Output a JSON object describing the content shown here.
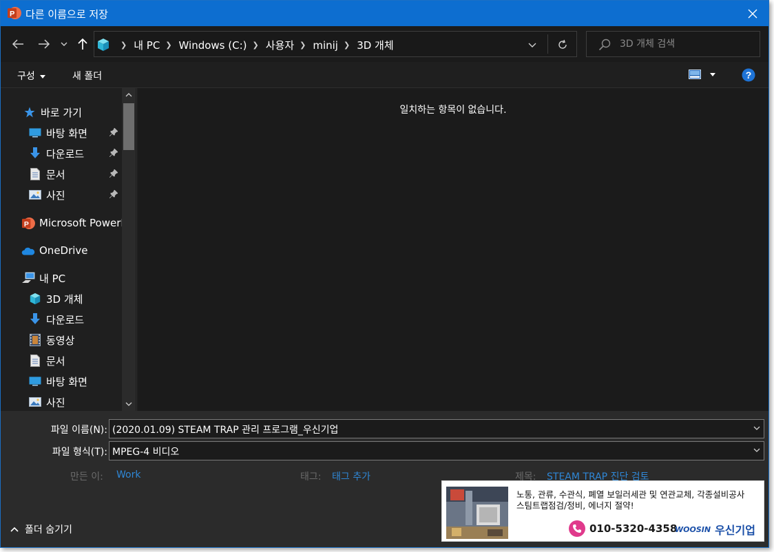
{
  "window": {
    "title": "다른 이름으로 저장",
    "app_icon": "powerpoint-icon",
    "accent_color": "#0d6ed0"
  },
  "navigation": {
    "breadcrumbs": [
      "내 PC",
      "Windows (C:)",
      "사용자",
      "minij",
      "3D 개체"
    ],
    "search_placeholder": "3D 개체 검색"
  },
  "toolbar": {
    "organize_label": "구성",
    "new_folder_label": "새 폴더"
  },
  "sidebar": {
    "items": [
      {
        "label": "바로 가기",
        "icon": "star-icon"
      },
      {
        "label": "바탕 화면",
        "icon": "desktop-icon",
        "pinned": true
      },
      {
        "label": "다운로드",
        "icon": "download-icon",
        "pinned": true
      },
      {
        "label": "문서",
        "icon": "document-icon",
        "pinned": true
      },
      {
        "label": "사진",
        "icon": "pictures-icon",
        "pinned": true
      },
      {
        "label": "Microsoft PowerPoint",
        "icon": "powerpoint-icon"
      },
      {
        "label": "OneDrive",
        "icon": "onedrive-icon"
      },
      {
        "label": "내 PC",
        "icon": "this-pc-icon"
      },
      {
        "label": "3D 개체",
        "icon": "3d-objects-icon"
      },
      {
        "label": "다운로드",
        "icon": "download-icon"
      },
      {
        "label": "동영상",
        "icon": "videos-icon"
      },
      {
        "label": "문서",
        "icon": "document-icon"
      },
      {
        "label": "바탕 화면",
        "icon": "desktop-icon"
      },
      {
        "label": "사진",
        "icon": "pictures-icon"
      }
    ]
  },
  "content": {
    "empty_message": "일치하는 항목이 없습니다."
  },
  "form": {
    "filename_label": "파일 이름(N):",
    "filename_value": "(2020.01.09) STEAM TRAP 관리 프로그램_우신기업",
    "filetype_label": "파일 형식(T):",
    "filetype_value": "MPEG-4 비디오",
    "authors_label": "만든 이:",
    "authors_value": "Work",
    "tags_label": "태그:",
    "tags_value": "태그 추가",
    "title_label": "제목:",
    "title_value": "STEAM TRAP 진단 검토",
    "hide_folders_label": "폴더 숨기기"
  },
  "ad": {
    "line1": "노통, 관류, 수관식, 폐열 보일러세관 및 연관교체, 각종설비공사",
    "line2": "스팀트랩점검/정비, 에너지 절약!",
    "phone": "010-5320-4358",
    "brand_en": "WOOSIN",
    "brand_ko": "우신기업"
  }
}
